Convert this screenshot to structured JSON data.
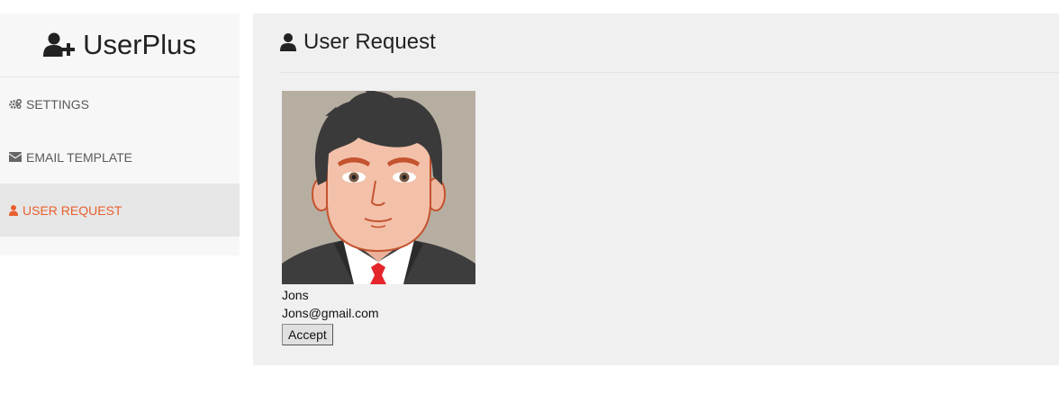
{
  "brand": {
    "title": "UserPlus",
    "icon": "user-plus-icon"
  },
  "sidebar": {
    "items": [
      {
        "label": "SETTINGS",
        "icon": "cogs-icon",
        "active": false
      },
      {
        "label": "EMAIL TEMPLATE",
        "icon": "envelope-icon",
        "active": false
      },
      {
        "label": "USER REQUEST",
        "icon": "user-icon",
        "active": true
      }
    ]
  },
  "main": {
    "title": "User Request",
    "title_icon": "user-icon"
  },
  "request": {
    "name": "Jons",
    "email": "Jons@gmail.com",
    "accept_label": "Accept"
  },
  "colors": {
    "accent": "#e9602e",
    "sidebar_bg": "#f7f7f7",
    "active_bg": "#e6e6e6",
    "main_bg": "#f0f0f0"
  }
}
